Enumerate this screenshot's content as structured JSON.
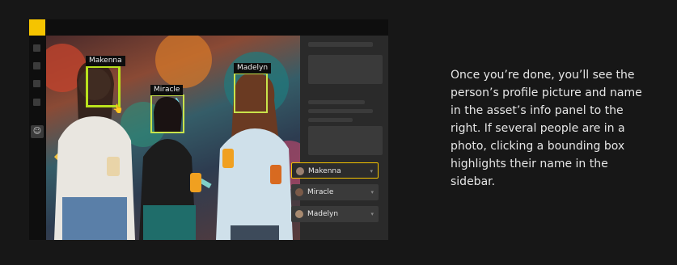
{
  "face_tags": {
    "makenna": "Makenna",
    "miracle": "Miracle",
    "madelyn": "Madelyn"
  },
  "sidebar": {
    "people": [
      {
        "name": "Makenna",
        "selected": true
      },
      {
        "name": "Miracle",
        "selected": false
      },
      {
        "name": "Madelyn",
        "selected": false
      }
    ],
    "chevron": "▾"
  },
  "rail": {
    "face_icon": "☺"
  },
  "description": "Once you’re done, you’ll see the person’s profile picture and name in the asset’s info panel to the right. If several people are in a photo, clicking a bounding box highlights their name in the sidebar.",
  "colors": {
    "accent": "#f5c400",
    "face_box": "#b9e11c",
    "background": "#171717"
  },
  "icons": [
    "face-icon",
    "cursor-icon",
    "chevron-down-icon"
  ]
}
